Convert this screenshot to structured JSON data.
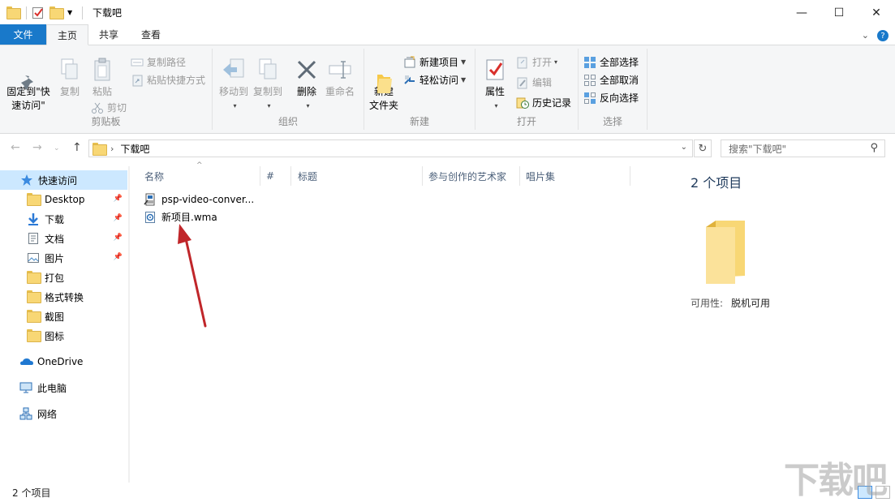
{
  "window": {
    "title": "下载吧",
    "minimize": "—",
    "maximize": "☐",
    "close": "✕"
  },
  "tabs": [
    {
      "label": "文件"
    },
    {
      "label": "主页"
    },
    {
      "label": "共享"
    },
    {
      "label": "查看"
    }
  ],
  "ribbon": {
    "clipboard": {
      "label": "剪贴板",
      "pin": "固定到\"快\n速访问\"",
      "copy": "复制",
      "paste": "粘贴",
      "copy_path": "复制路径",
      "paste_shortcut": "粘贴快捷方式",
      "cut": "剪切"
    },
    "organize": {
      "label": "组织",
      "move_to": "移动到",
      "copy_to": "复制到",
      "delete": "删除",
      "rename": "重命名"
    },
    "new": {
      "label": "新建",
      "new_folder": "新建\n文件夹",
      "new_item": "新建项目",
      "easy_access": "轻松访问"
    },
    "open": {
      "label": "打开",
      "properties": "属性",
      "open": "打开",
      "edit": "编辑",
      "history": "历史记录"
    },
    "select": {
      "label": "选择",
      "select_all": "全部选择",
      "select_none": "全部取消",
      "invert": "反向选择"
    }
  },
  "address": {
    "path": "下载吧",
    "search_placeholder": "搜索\"下载吧\""
  },
  "nav": {
    "quick_access": "快速访问",
    "items": [
      {
        "label": "Desktop",
        "pinned": true
      },
      {
        "label": "下载",
        "pinned": true
      },
      {
        "label": "文档",
        "pinned": true
      },
      {
        "label": "图片",
        "pinned": true
      },
      {
        "label": "打包",
        "pinned": false
      },
      {
        "label": "格式转换",
        "pinned": false
      },
      {
        "label": "截图",
        "pinned": false
      },
      {
        "label": "图标",
        "pinned": false
      }
    ],
    "onedrive": "OneDrive",
    "this_pc": "此电脑",
    "network": "网络"
  },
  "columns": [
    "名称",
    "#",
    "标题",
    "参与创作的艺术家",
    "唱片集"
  ],
  "files": [
    {
      "name": "psp-video-conver..."
    },
    {
      "name": "新项目.wma"
    }
  ],
  "details": {
    "count": "2 个项目",
    "availability_label": "可用性:",
    "availability_value": "脱机可用"
  },
  "status": {
    "count": "2 个项目"
  },
  "watermark": "下载吧",
  "colors": {
    "accent": "#1979ca",
    "selected": "#cce8ff",
    "arrow": "#c0262a"
  }
}
